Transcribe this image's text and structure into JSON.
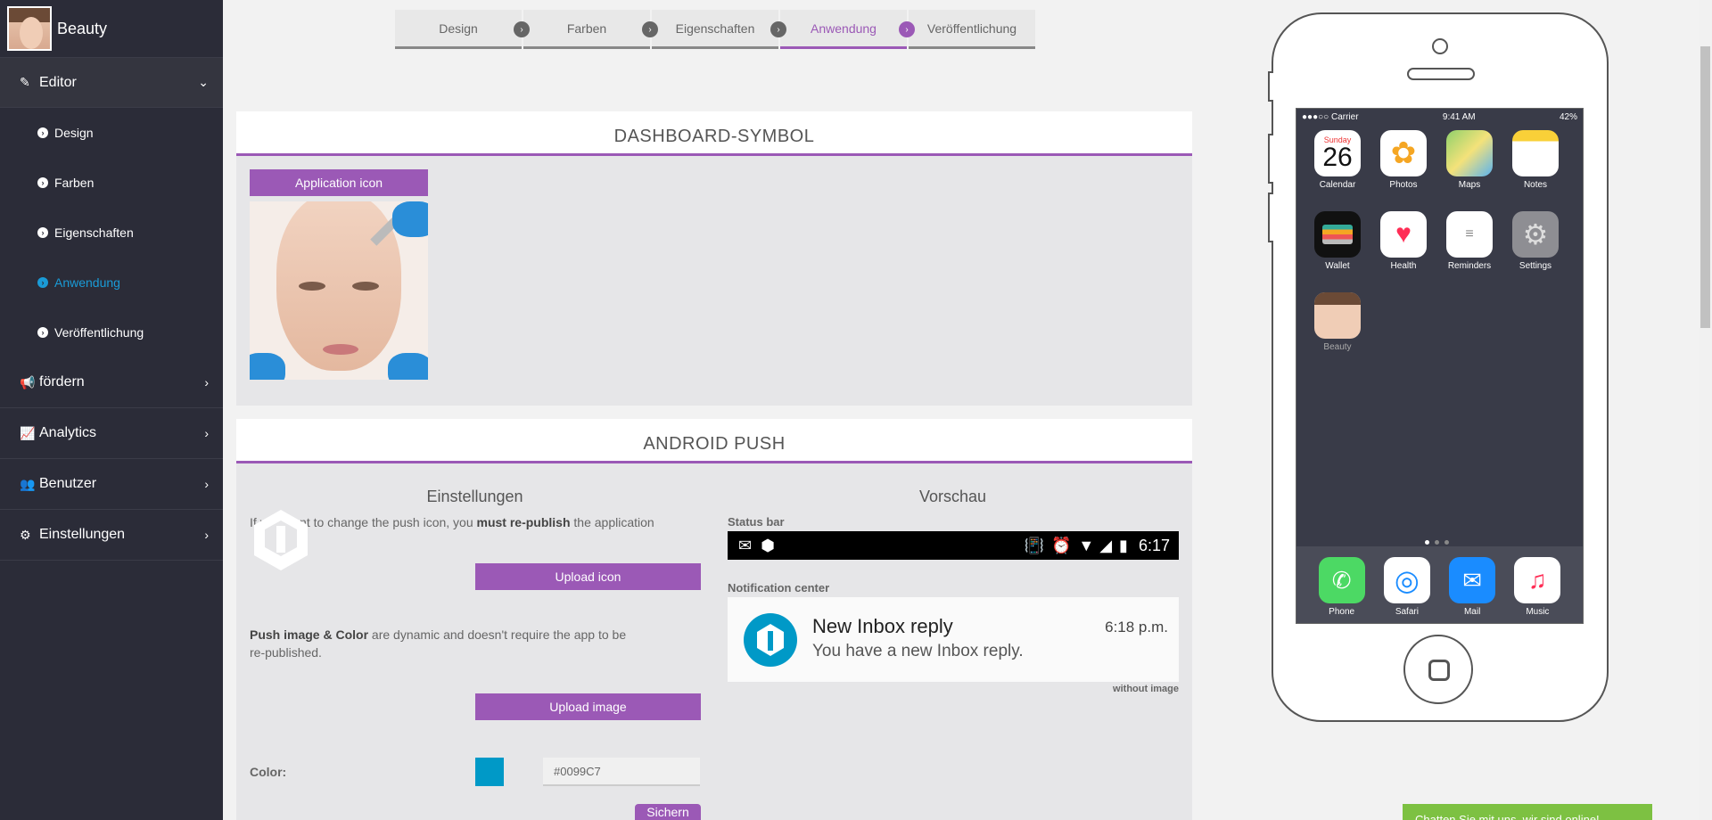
{
  "brand": {
    "title": "Beauty"
  },
  "sidebar": {
    "editor": {
      "label": "Editor",
      "sub": [
        {
          "label": "Design"
        },
        {
          "label": "Farben"
        },
        {
          "label": "Eigenschaften"
        },
        {
          "label": "Anwendung"
        },
        {
          "label": "Veröffentlichung"
        }
      ]
    },
    "items": [
      {
        "label": "fördern"
      },
      {
        "label": "Analytics"
      },
      {
        "label": "Benutzer"
      },
      {
        "label": "Einstellungen"
      }
    ]
  },
  "steps": [
    {
      "label": "Design"
    },
    {
      "label": "Farben"
    },
    {
      "label": "Eigenschaften"
    },
    {
      "label": "Anwendung"
    },
    {
      "label": "Veröffentlichung"
    }
  ],
  "dashboard": {
    "title": "DASHBOARD-SYMBOL",
    "button": "Application icon"
  },
  "android": {
    "title": "ANDROID PUSH",
    "settings_title": "Einstellungen",
    "info_pre": "If you want to change the push icon, you ",
    "info_bold": "must re-publish",
    "info_post": " the application",
    "upload_icon": "Upload icon",
    "dyn_bold": "Push image & Color",
    "dyn_text1": " are dynamic and doesn't require the app to be",
    "dyn_text2": "re-published.",
    "upload_image": "Upload image",
    "color_label": "Color:",
    "color_value": "#0099C7",
    "save": "Sichern",
    "preview_title": "Vorschau",
    "statusbar_label": "Status bar",
    "time": "6:17",
    "notif_center_label": "Notification center",
    "notif_title": "New Inbox reply",
    "notif_time": "6:18 p.m.",
    "notif_body": "You have a new Inbox reply.",
    "without_image": "without image"
  },
  "phone": {
    "carrier": "Carrier",
    "time": "9:41 AM",
    "battery": "42%",
    "calendar_day": "Sunday",
    "calendar_date": "26",
    "apps": [
      {
        "label": "Calendar"
      },
      {
        "label": "Photos"
      },
      {
        "label": "Maps"
      },
      {
        "label": "Notes"
      },
      {
        "label": "Wallet"
      },
      {
        "label": "Health"
      },
      {
        "label": "Reminders"
      },
      {
        "label": "Settings"
      },
      {
        "label": "Beauty"
      }
    ],
    "dock": [
      {
        "label": "Phone"
      },
      {
        "label": "Safari"
      },
      {
        "label": "Mail"
      },
      {
        "label": "Music"
      }
    ]
  },
  "chat": {
    "text": "Chatten Sie mit uns, wir sind online!"
  },
  "colors": {
    "accent": "#9b59b6",
    "active": "#1a9bd7",
    "push": "#0099c7",
    "sidebar": "#2b2c38"
  }
}
